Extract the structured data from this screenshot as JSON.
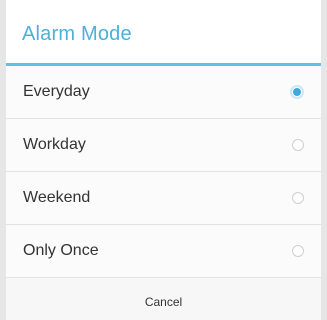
{
  "dialog": {
    "title": "Alarm Mode",
    "options": [
      {
        "label": "Everyday",
        "selected": true
      },
      {
        "label": "Workday",
        "selected": false
      },
      {
        "label": "Weekend",
        "selected": false
      },
      {
        "label": "Only Once",
        "selected": false
      }
    ],
    "cancel_label": "Cancel"
  },
  "colors": {
    "accent": "#4bb1d9",
    "divider_accent": "#5ec1e6",
    "radio_selected": "#3fa8dc"
  },
  "icons": {
    "selected": "radio-checked-icon",
    "unselected": "radio-unchecked-icon"
  }
}
